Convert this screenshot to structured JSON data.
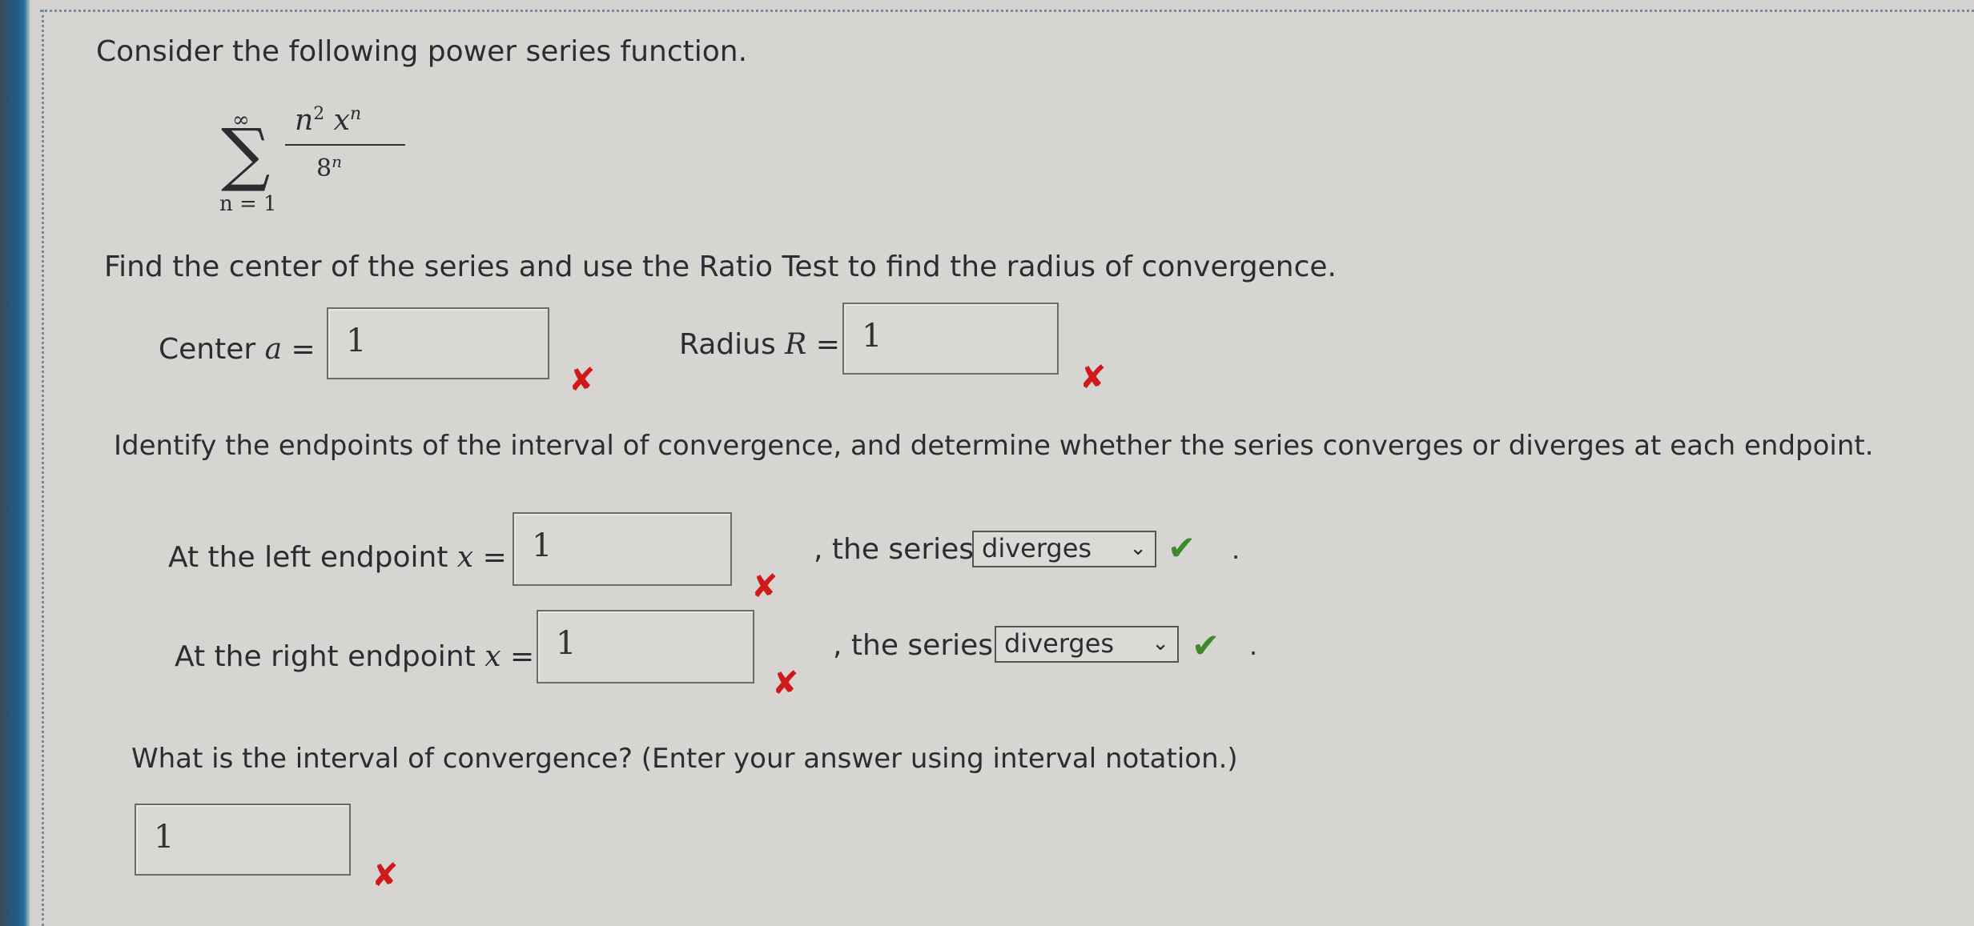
{
  "intro": "Consider the following power series function.",
  "series": {
    "upper_limit": "∞",
    "lower_limit": "n = 1",
    "numerator_base": "n",
    "numerator_exp": "2",
    "numerator_var": "x",
    "numerator_var_exp": "n",
    "denominator_base": "8",
    "denominator_exp": "n"
  },
  "q1": {
    "prompt": "Find the center of the series and use the Ratio Test to find the radius of convergence.",
    "center_label_prefix": "Center ",
    "center_label_var": "a",
    "center_label_suffix": " =",
    "center_value": "1",
    "radius_label_prefix": "Radius ",
    "radius_label_var": "R",
    "radius_label_suffix": " =",
    "radius_value": "1"
  },
  "q2": {
    "prompt": "Identify the endpoints of the interval of convergence, and determine whether the series converges or diverges at each endpoint.",
    "left_label": "At the left endpoint ",
    "right_label": "At the right endpoint ",
    "var_x": "x",
    "eq": " =",
    "left_value": "1",
    "right_value": "1",
    "the_series": ", the series",
    "left_select": "diverges",
    "right_select": "diverges"
  },
  "q3": {
    "prompt": "What is the interval of convergence? (Enter your answer using interval notation.)",
    "value": "1"
  },
  "marks": {
    "incorrect": "✘",
    "correct": "✔",
    "chevron": "⌄",
    "period": "."
  },
  "colors": {
    "incorrect": "#d01a1a",
    "correct": "#3e8a2a",
    "accent_bezel": "#1f5c86"
  }
}
